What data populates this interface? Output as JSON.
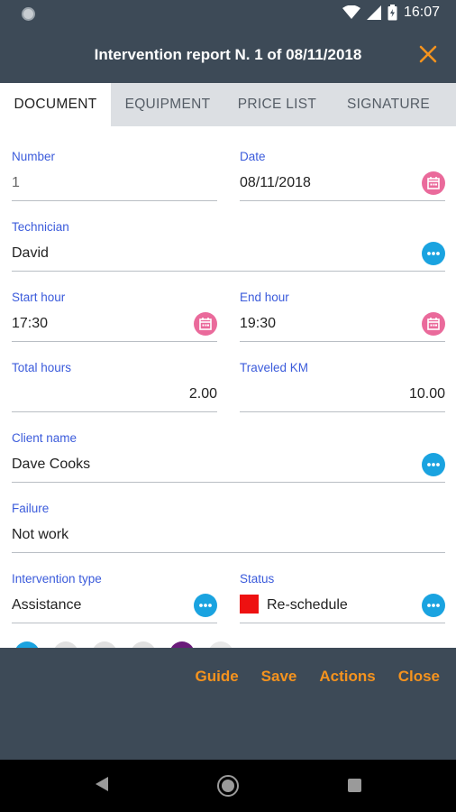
{
  "status_bar": {
    "time": "16:07"
  },
  "app_bar": {
    "title": "Intervention report N. 1 of 08/11/2018"
  },
  "tabs": [
    {
      "label": "DOCUMENT",
      "active": true
    },
    {
      "label": "EQUIPMENT",
      "active": false
    },
    {
      "label": "PRICE LIST",
      "active": false
    },
    {
      "label": "SIGNATURE",
      "active": false
    }
  ],
  "form": {
    "number": {
      "label": "Number",
      "value": "1"
    },
    "date": {
      "label": "Date",
      "value": "08/11/2018"
    },
    "technician": {
      "label": "Technician",
      "value": "David"
    },
    "start_hour": {
      "label": "Start hour",
      "value": "17:30"
    },
    "end_hour": {
      "label": "End hour",
      "value": "19:30"
    },
    "total_hours": {
      "label": "Total hours",
      "value": "2.00"
    },
    "traveled_km": {
      "label": "Traveled KM",
      "value": "10.00"
    },
    "client_name": {
      "label": "Client name",
      "value": "Dave Cooks"
    },
    "failure": {
      "label": "Failure",
      "value": "Not work"
    },
    "intervention_type": {
      "label": "Intervention type",
      "value": "Assistance"
    },
    "status": {
      "label": "Status",
      "value": "Re-schedule",
      "color": "#ee1111"
    }
  },
  "color_circles": [
    "#1aa3e0",
    "#e0e0e0",
    "#e0e0e0",
    "#e0e0e0",
    "#6a1b7a",
    "#e8e8e8"
  ],
  "bottom_actions": {
    "guide": "Guide",
    "save": "Save",
    "actions": "Actions",
    "close": "Close"
  },
  "colors": {
    "primary_dark": "#3d4a57",
    "accent_orange": "#f5931e",
    "label_blue": "#3b5bdb",
    "calendar_pink": "#ea6a9b",
    "more_blue": "#1aa3e0"
  }
}
